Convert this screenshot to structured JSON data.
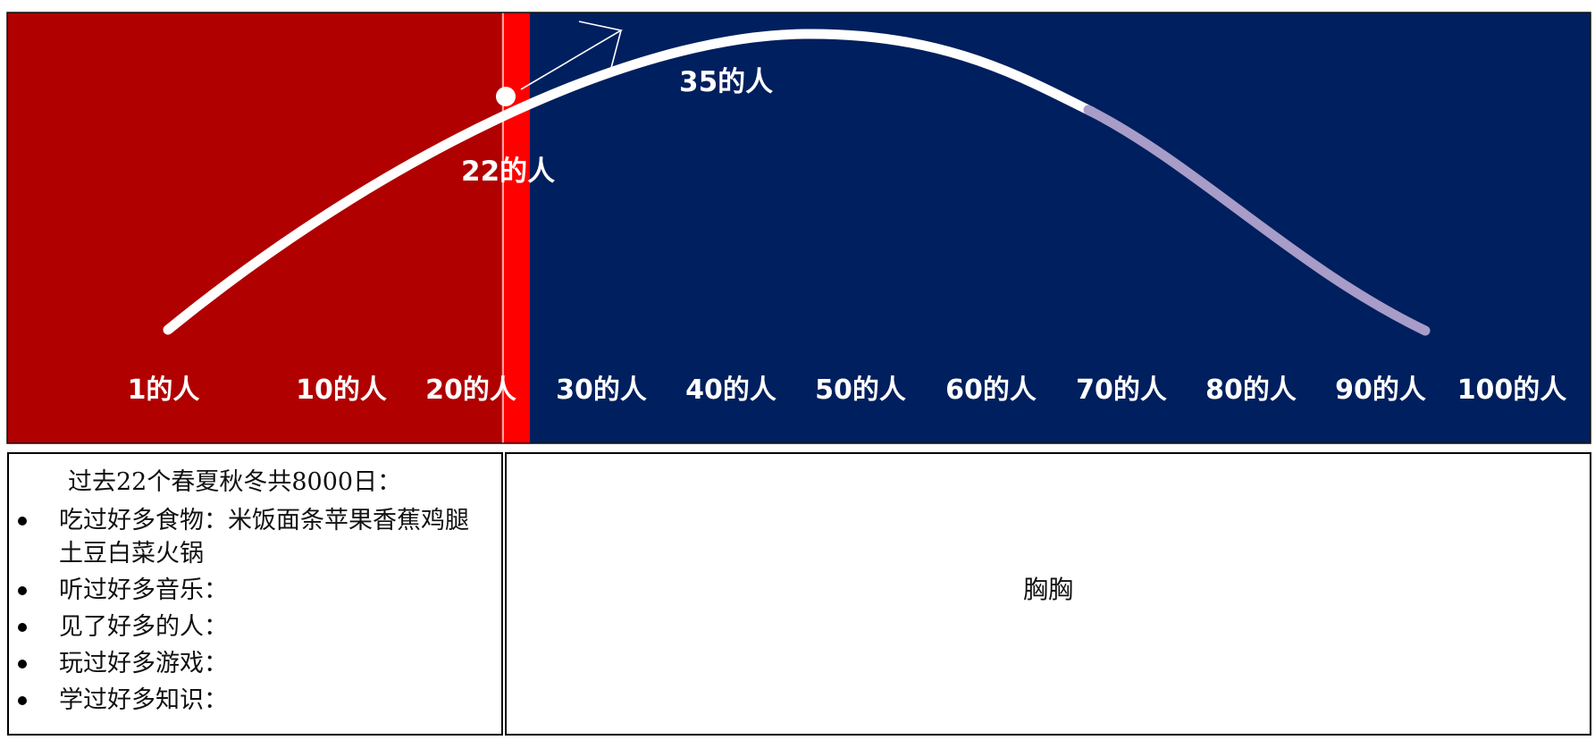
{
  "colors": {
    "past_region": "#b00000",
    "current_stripe": "#ff0000",
    "future_region": "#001f5e",
    "curve": "#ffffff",
    "curve_faded": "#a89cc8"
  },
  "life_scale": {
    "ticks": [
      "1的人",
      "10的人",
      "20的人",
      "30的人",
      "40的人",
      "50的人",
      "60的人",
      "70的人",
      "80的人",
      "90的人",
      "100的人"
    ],
    "current_marker_label": "22的人",
    "peak_label": "35的人"
  },
  "left_panel": {
    "intro": "过去22个春夏秋冬共8000日：",
    "items": [
      "吃过好多食物：米饭面条苹果香蕉鸡腿土豆白菜火锅",
      "听过好多音乐：",
      "见了好多的人：",
      "玩过好多游戏：",
      "学过好多知识："
    ]
  },
  "right_panel": {
    "text": "胸胸"
  }
}
